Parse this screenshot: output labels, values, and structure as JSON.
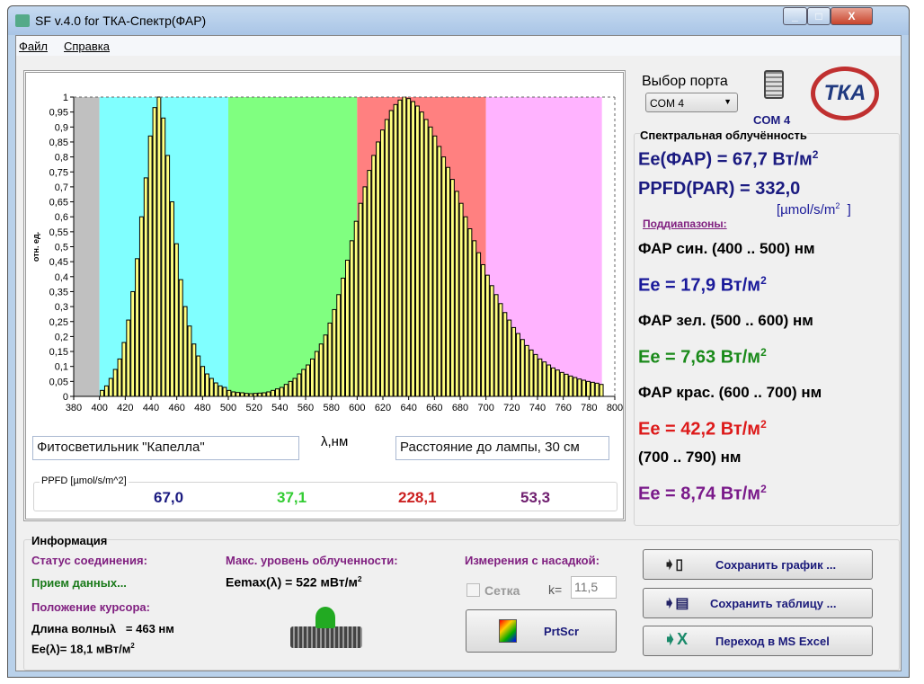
{
  "window": {
    "title": "SF v.4.0 for ТКА-Спектр(ФАР)",
    "minimize": "_",
    "maximize": "□",
    "close": "X"
  },
  "menu": [
    "Файл",
    "Справка"
  ],
  "chart_data": {
    "type": "bar",
    "ylabel": "отн. ед.",
    "xlabel": "λ,нм",
    "xlim": [
      380,
      800
    ],
    "ylim": [
      0,
      1
    ],
    "xticks": [
      "380",
      "400",
      "420",
      "440",
      "460",
      "480",
      "500",
      "520",
      "540",
      "560",
      "580",
      "600",
      "620",
      "640",
      "660",
      "680",
      "700",
      "720",
      "740",
      "760",
      "780",
      "800"
    ],
    "yticks": [
      "0",
      "0,05",
      "0,1",
      "0,15",
      "0,2",
      "0,25",
      "0,3",
      "0,35",
      "0,4",
      "0,45",
      "0,5",
      "0,55",
      "0,6",
      "0,65",
      "0,7",
      "0,75",
      "0,8",
      "0,85",
      "0,9",
      "0,95",
      "1"
    ],
    "bands": [
      {
        "from": 380,
        "to": 400,
        "color": "#c0c0c0"
      },
      {
        "from": 400,
        "to": 500,
        "color": "#80ffff"
      },
      {
        "from": 500,
        "to": 600,
        "color": "#80ff80"
      },
      {
        "from": 600,
        "to": 700,
        "color": "#ff8080"
      },
      {
        "from": 700,
        "to": 790,
        "color": "#ffb3ff"
      }
    ],
    "bar_color": "#ffff80",
    "x_start": 402,
    "x_step": 3.4,
    "values": [
      0.02,
      0.035,
      0.06,
      0.09,
      0.125,
      0.18,
      0.255,
      0.35,
      0.46,
      0.6,
      0.73,
      0.87,
      0.965,
      1.0,
      0.93,
      0.805,
      0.65,
      0.51,
      0.39,
      0.3,
      0.235,
      0.175,
      0.135,
      0.1,
      0.075,
      0.06,
      0.045,
      0.035,
      0.03,
      0.02,
      0.015,
      0.013,
      0.012,
      0.01,
      0.009,
      0.01,
      0.011,
      0.012,
      0.015,
      0.02,
      0.025,
      0.03,
      0.04,
      0.05,
      0.06,
      0.075,
      0.09,
      0.105,
      0.125,
      0.15,
      0.175,
      0.205,
      0.245,
      0.29,
      0.34,
      0.395,
      0.455,
      0.52,
      0.585,
      0.645,
      0.7,
      0.755,
      0.805,
      0.85,
      0.89,
      0.925,
      0.955,
      0.975,
      0.99,
      1.0,
      0.995,
      0.985,
      0.97,
      0.95,
      0.925,
      0.9,
      0.87,
      0.835,
      0.8,
      0.765,
      0.725,
      0.685,
      0.645,
      0.6,
      0.56,
      0.52,
      0.48,
      0.44,
      0.405,
      0.37,
      0.34,
      0.31,
      0.28,
      0.255,
      0.23,
      0.21,
      0.19,
      0.17,
      0.155,
      0.14,
      0.125,
      0.115,
      0.105,
      0.095,
      0.088,
      0.08,
      0.074,
      0.068,
      0.063,
      0.058,
      0.054,
      0.05,
      0.047,
      0.044,
      0.04
    ],
    "grid": false
  },
  "lamp_name": "Фитосветильник \"Капелла\"",
  "distance": "Расстояние до лампы, 30 см",
  "ppfd": {
    "label": "PPFD [µmol/s/m^2]",
    "values": [
      "67,0",
      "37,1",
      "228,1",
      "53,3"
    ],
    "colors": [
      "#1a1a80",
      "#33cc33",
      "#cc2222",
      "#702070"
    ]
  },
  "port": {
    "label": "Выбор порта",
    "selected": "COM 4",
    "status": "COM 4"
  },
  "logo": "ТКА",
  "irradiance": {
    "title": "Спектральная облучённость",
    "ee_par": "Ee(ФАР) = 67,7 Вт/м",
    "ee_sup": "2",
    "ppfd": "PPFD(PAR) = 332,0",
    "ppfd_unit": "[µmol/s/m",
    "ppfd_unit_end": "]",
    "subranges": "Поддиапазоны:",
    "bands": [
      {
        "label": "ФАР син. (400 .. 500) нм",
        "value": "Ee = 17,9 Вт/м",
        "color": "#1a1a9a"
      },
      {
        "label": "ФАР зел. (500 .. 600) нм",
        "value": "Ee = 7,63 Вт/м",
        "color": "#1a8a1a"
      },
      {
        "label": "ФАР крас. (600 .. 700) нм",
        "value": "Ee = 42,2 Вт/м",
        "color": "#dd1a1a"
      },
      {
        "label": "(700 .. 790) нм",
        "value": "Ee = 8,74 Вт/м",
        "color": "#7a1a8a"
      }
    ]
  },
  "info": {
    "title": "Информация",
    "status_label": "Статус соединения:",
    "status": "Прием данных...",
    "cursor_label": "Положение курсора:",
    "wavelength": "Длина волныλ   = 463 нм",
    "ee_lambda": "Ee(λ)= 18,1 мВт/м",
    "sup": "2",
    "max_label": "Макс. уровень облученности:",
    "eemax": "Eemax(λ) = 522 мВт/м",
    "nozzle_label": "Измерения с насадкой:",
    "grid_checkbox": "Сетка",
    "k_label": "k=",
    "k_value": "11,5",
    "prtscr": "PrtScr"
  },
  "buttons": {
    "save_chart": "Сохранить график ...",
    "save_table": "Сохранить таблицу ...",
    "excel": "Переход в MS Excel"
  }
}
